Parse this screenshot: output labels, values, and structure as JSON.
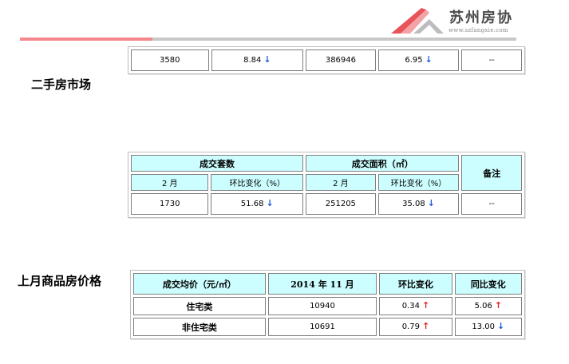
{
  "header": {
    "logo_text": "苏州房协",
    "logo_url": "www.szfangxie.com"
  },
  "colors": {
    "header_cell": "#ccfeff",
    "arrow_down": "#1a5bd6",
    "arrow_up": "#e02020",
    "bar_red": "#f5878d",
    "bar_gray": "#c8c8c8"
  },
  "top_table": {
    "row": [
      {
        "value": "3580"
      },
      {
        "value": "8.84",
        "arrow": "down"
      },
      {
        "value": "386946"
      },
      {
        "value": "6.95",
        "arrow": "down"
      },
      {
        "value": "--"
      }
    ]
  },
  "second_hand": {
    "title": "二手房市场",
    "headers": {
      "volume": "成交套数",
      "area": "成交面积（㎡）",
      "note": "备注"
    },
    "subheaders": {
      "month1": "2 月",
      "change1": "环比变化（%）",
      "month2": "2 月",
      "change2": "环比变化（%）"
    },
    "row": [
      {
        "value": "1730"
      },
      {
        "value": "51.68",
        "arrow": "down"
      },
      {
        "value": "251205"
      },
      {
        "value": "35.08",
        "arrow": "down"
      },
      {
        "value": "--"
      }
    ]
  },
  "price": {
    "title": "上月商品房价格",
    "headers": {
      "avg": "成交均价（元/㎡）",
      "month": "2014 年 11 月",
      "mom": "环比变化",
      "yoy": "同比变化"
    },
    "rows": [
      {
        "label": "住宅类",
        "price": "10940",
        "mom": "0.34",
        "mom_arrow": "up",
        "yoy": "5.06",
        "yoy_arrow": "up"
      },
      {
        "label": "非住宅类",
        "price": "10691",
        "mom": "0.79",
        "mom_arrow": "up",
        "yoy": "13.00",
        "yoy_arrow": "down"
      }
    ]
  },
  "icons": {
    "down": "arrow-down-icon",
    "up": "arrow-up-icon"
  }
}
